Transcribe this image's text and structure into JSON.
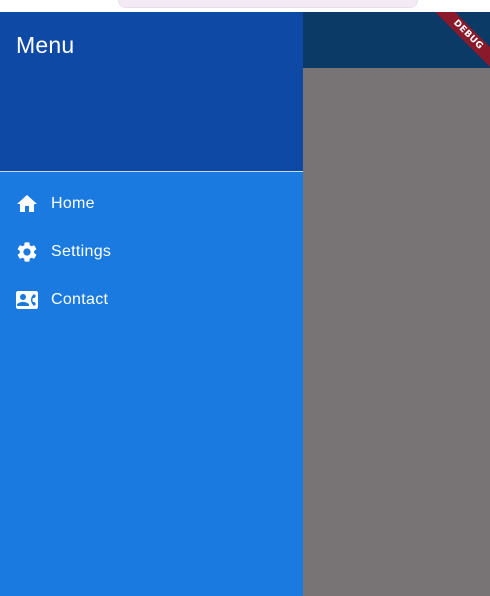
{
  "drawer": {
    "title": "Menu",
    "items": [
      {
        "label": "Home",
        "icon": "home-icon"
      },
      {
        "label": "Settings",
        "icon": "gear-icon"
      },
      {
        "label": "Contact",
        "icon": "contact-card-icon"
      }
    ]
  },
  "debug_banner": {
    "label": "DEBUG"
  },
  "colors": {
    "drawer_header": "#0f49a6",
    "drawer_body": "#1a7ae0",
    "app_bar": "#0b3a66",
    "scrim": "#787374",
    "debug_ribbon": "#8a1a2b"
  }
}
